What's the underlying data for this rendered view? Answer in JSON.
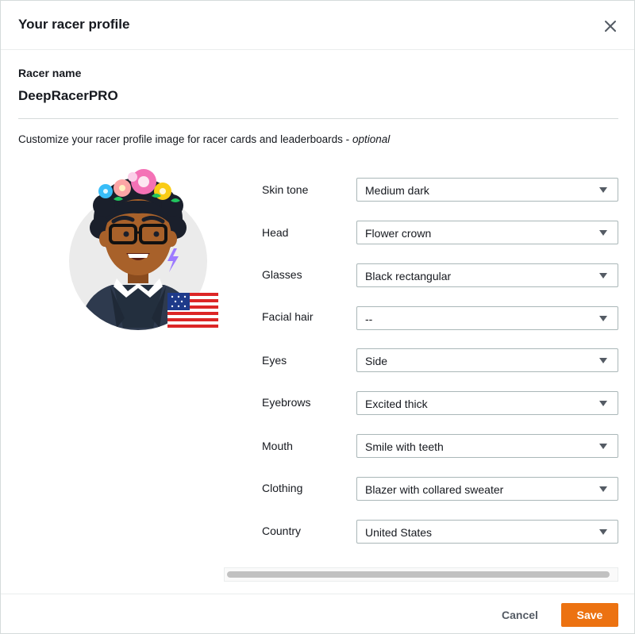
{
  "dialog": {
    "title": "Your racer profile",
    "close_icon": "close-icon"
  },
  "racer": {
    "label": "Racer name",
    "name": "DeepRacerPRO"
  },
  "description": {
    "text": "Customize your racer profile image for racer cards and leaderboards - ",
    "optional": "optional"
  },
  "avatar": {
    "icon": "racer-avatar-icon",
    "flag_icon": "us-flag-icon"
  },
  "fields": [
    {
      "label": "Skin tone",
      "value": "Medium dark"
    },
    {
      "label": "Head",
      "value": "Flower crown"
    },
    {
      "label": "Glasses",
      "value": "Black rectangular"
    },
    {
      "label": "Facial hair",
      "value": "--"
    },
    {
      "label": "Eyes",
      "value": "Side"
    },
    {
      "label": "Eyebrows",
      "value": "Excited thick"
    },
    {
      "label": "Mouth",
      "value": "Smile with teeth"
    },
    {
      "label": "Clothing",
      "value": "Blazer with collared sweater"
    },
    {
      "label": "Country",
      "value": "United States"
    }
  ],
  "footer": {
    "cancel_label": "Cancel",
    "save_label": "Save"
  },
  "colors": {
    "primary": "#ec7211",
    "text": "#16191f",
    "border": "#aab7b8"
  }
}
